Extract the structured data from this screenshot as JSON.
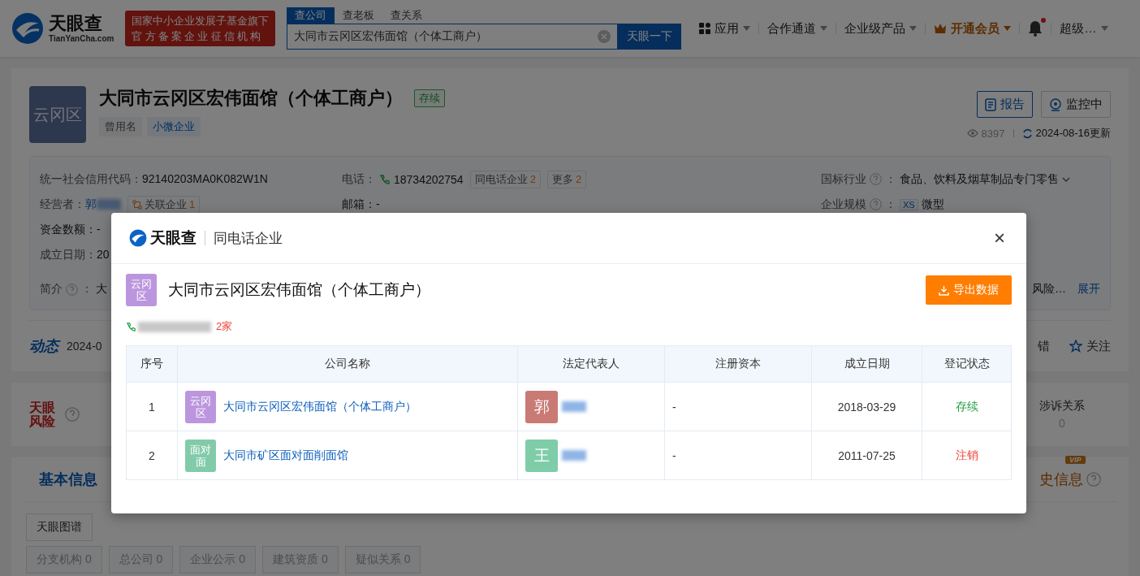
{
  "header": {
    "logo": {
      "name": "天眼查",
      "sub": "TianYanCha.com"
    },
    "banner": [
      "国家中小企业发展子基金旗下",
      "官方备案企业征信机构"
    ],
    "search": {
      "tabs": [
        {
          "label": "查公司",
          "selected": true
        },
        {
          "label": "查老板",
          "selected": false
        },
        {
          "label": "查关系",
          "selected": false
        }
      ],
      "value": "大同市云冈区宏伟面馆（个体工商户）",
      "button": "天眼一下"
    },
    "nav": [
      {
        "label": "应用",
        "kind": "apps"
      },
      {
        "label": "合作通道",
        "kind": "menu"
      },
      {
        "label": "企业级产品",
        "kind": "menu"
      },
      {
        "label": "开通会员",
        "kind": "vip"
      }
    ],
    "bell_unread": true,
    "user": "超级…"
  },
  "company": {
    "avatar": "云冈区",
    "name": "大同市云冈区宏伟面馆（个体工商户）",
    "status": "存续",
    "tags": [
      {
        "label": "曾用名",
        "kind": "plain"
      },
      {
        "label": "小微企业",
        "kind": "blue"
      }
    ],
    "buttons": [
      {
        "label": "报告",
        "kind": "report"
      },
      {
        "label": "监控中",
        "kind": "monitor"
      }
    ],
    "views": "8397",
    "updated": "2024-08-16更新",
    "info": [
      [
        {
          "label": "统一社会信用代码：",
          "value": "92140203MA0K082W1N"
        },
        {
          "label": "经营者：",
          "value": "郭",
          "redacted": true,
          "chips": [
            {
              "label": "关联企业",
              "count": "1",
              "kind": "related"
            }
          ]
        },
        {
          "text": "资金数额：-"
        },
        {
          "label": "成立日期：",
          "value": "20"
        }
      ],
      [
        {
          "label": "电话：",
          "value": "18734202754",
          "phone": true,
          "chips": [
            {
              "label": "同电话企业",
              "count": "2",
              "kind": "plain"
            },
            {
              "label": "更多",
              "count": "2",
              "kind": "plain"
            }
          ]
        },
        {
          "text": "邮箱：-"
        }
      ],
      [
        {
          "label": "国标行业",
          "help": true,
          "colon": "：",
          "value": "食品、饮料及烟草制品专门零售",
          "dropdown": true
        },
        {
          "label": "企业规模",
          "help": true,
          "colon": "：",
          "badge": "XS",
          "value": "微型"
        }
      ]
    ],
    "intro": {
      "label": "简介",
      "colon": "：",
      "value": "大",
      "tail": "风险…",
      "link": "展开"
    }
  },
  "dynamic": {
    "title": "动态",
    "value": "2024-0",
    "actions": [
      {
        "label": "错",
        "kind": "plain"
      },
      {
        "label": "关注",
        "kind": "star"
      }
    ]
  },
  "risk": {
    "title": [
      "天眼",
      "风险"
    ],
    "item": {
      "label": "涉诉关系",
      "count": "0"
    }
  },
  "tabs": [
    {
      "label": "基本信息",
      "selected": true,
      "vip": false
    },
    {
      "label": "史信息",
      "selected": false,
      "vip": true,
      "vip_label": "VIP"
    }
  ],
  "graph_button": "天眼图谱",
  "chips": [
    "分支机构 0",
    "总公司 0",
    "企业公示 0",
    "建筑资质 0",
    "疑似关系 0"
  ],
  "modal": {
    "logo": "天眼查",
    "title": "同电话企业",
    "close": "×",
    "company": {
      "avatar": "云冈区",
      "name": "大同市云冈区宏伟面馆（个体工商户）"
    },
    "export": "导出数据",
    "count": "2家",
    "columns": [
      "序号",
      "公司名称",
      "法定代表人",
      "注册资本",
      "成立日期",
      "登记状态"
    ],
    "rows": [
      {
        "index": "1",
        "avatar": {
          "text": "云冈区",
          "color": "#bb96de"
        },
        "name": "大同市云冈区宏伟面馆（个体工商户）",
        "rep": {
          "avatar": "郭",
          "color": "#c97a74"
        },
        "capital": "-",
        "date": "2018-03-29",
        "status": {
          "text": "存续",
          "color": "#1f9d3c"
        }
      },
      {
        "index": "2",
        "avatar": {
          "text": "面对面",
          "color": "#82cba9"
        },
        "name": "大同市矿区面对面削面馆",
        "rep": {
          "avatar": "王",
          "color": "#7fcca9"
        },
        "capital": "-",
        "date": "2011-07-25",
        "status": {
          "text": "注销",
          "color": "#f04134"
        }
      }
    ]
  }
}
